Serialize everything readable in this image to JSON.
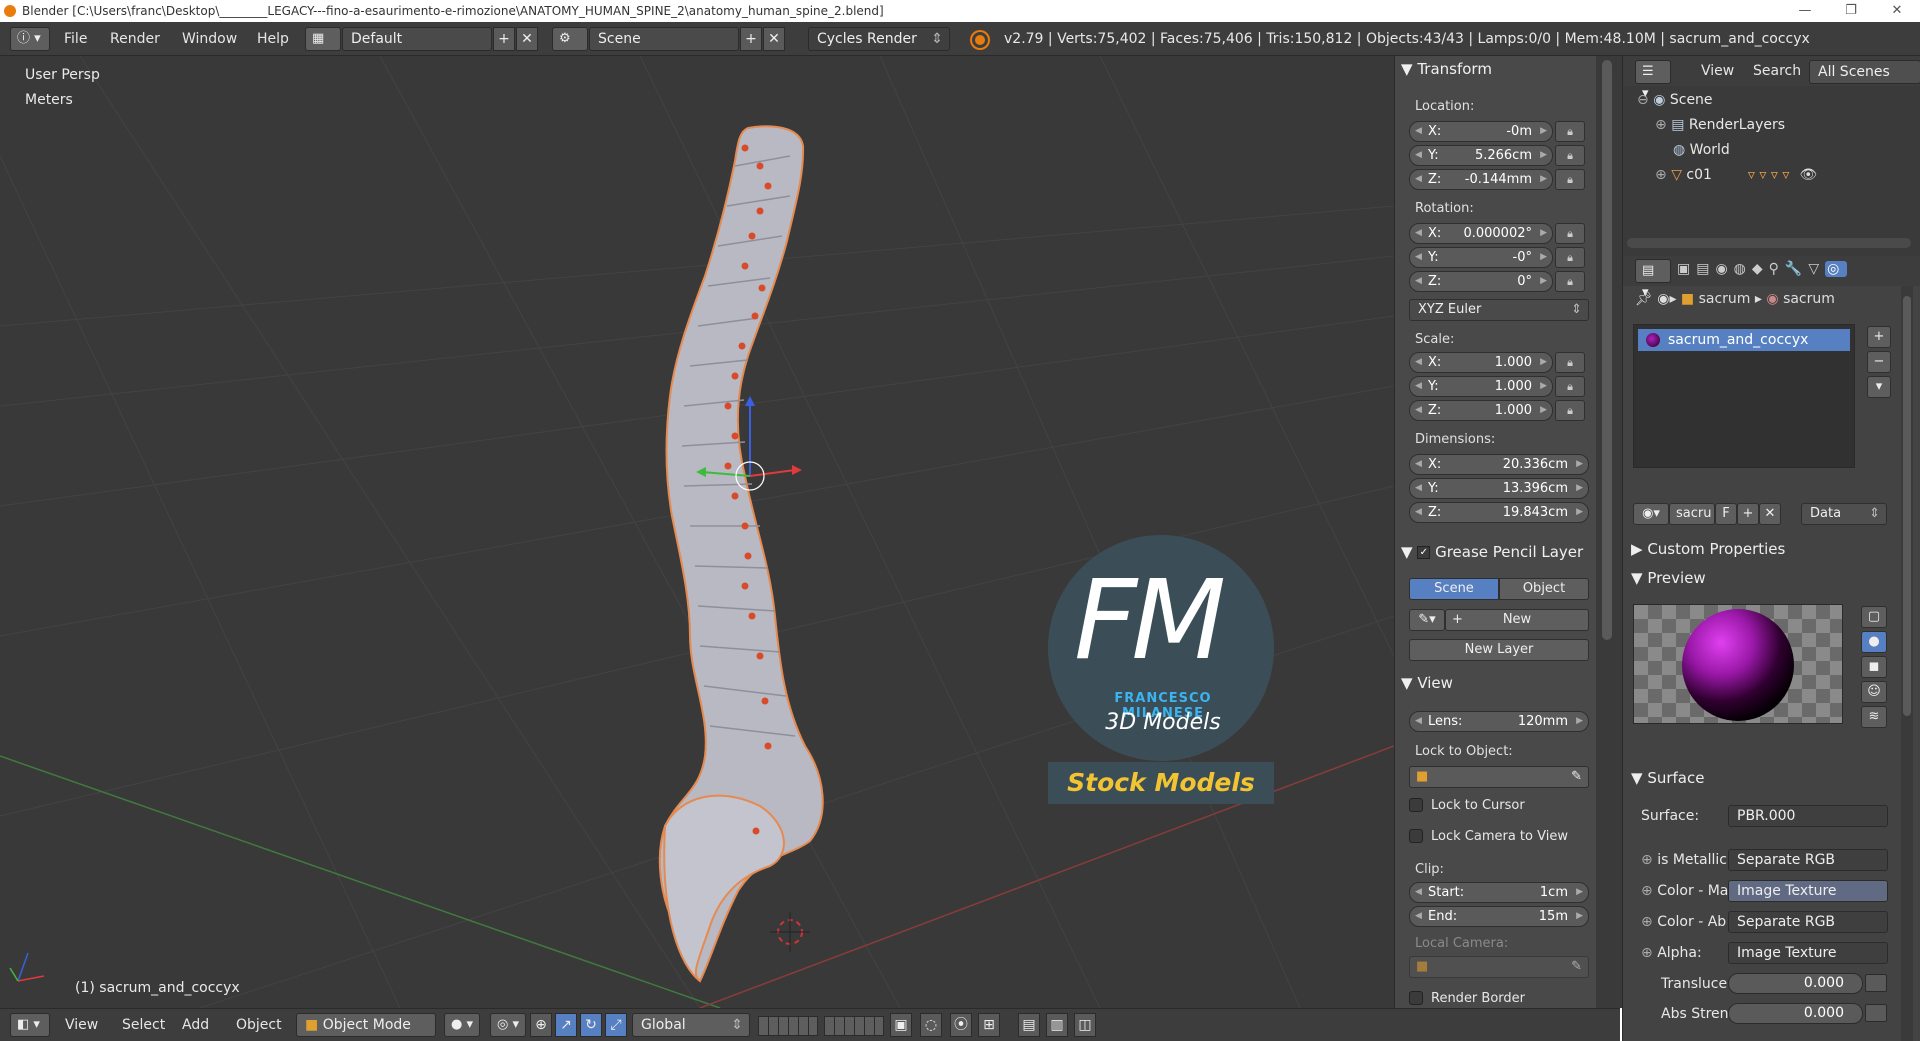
{
  "window": {
    "title": "Blender [C:\\Users\\franc\\Desktop\\________LEGACY---fino-a-esaurimento-e-rimozione\\ANATOMY_HUMAN_SPINE_2\\anatomy_human_spine_2.blend]",
    "minimize": "—",
    "maximize": "❐",
    "close": "✕"
  },
  "header": {
    "menus": [
      "File",
      "Render",
      "Window",
      "Help"
    ],
    "screen_layout": "Default",
    "scene": "Scene",
    "render_engine": "Cycles Render",
    "stats": "v2.79 | Verts:75,402 | Faces:75,406 | Tris:150,812 | Objects:43/43 | Lamps:0/0 | Mem:48.10M | sacrum_and_coccyx"
  },
  "viewport": {
    "view_name": "User Persp",
    "units": "Meters",
    "active_object": "(1) sacrum_and_coccyx",
    "watermark_initials": "FM",
    "watermark_name": "FRANCESCO MILANESE",
    "watermark_sub": "3D Models",
    "watermark_banner": "Stock Models"
  },
  "view3d_header": {
    "menus": [
      "View",
      "Select",
      "Add",
      "Object"
    ],
    "mode": "Object Mode",
    "orientation": "Global"
  },
  "transform": {
    "title": "Transform",
    "location_label": "Location:",
    "location": [
      {
        "axis": "X:",
        "value": "-0m"
      },
      {
        "axis": "Y:",
        "value": "5.266cm"
      },
      {
        "axis": "Z:",
        "value": "-0.144mm"
      }
    ],
    "rotation_label": "Rotation:",
    "rotation": [
      {
        "axis": "X:",
        "value": "0.000002°"
      },
      {
        "axis": "Y:",
        "value": "-0°"
      },
      {
        "axis": "Z:",
        "value": "0°"
      }
    ],
    "rotation_mode": "XYZ Euler",
    "scale_label": "Scale:",
    "scale": [
      {
        "axis": "X:",
        "value": "1.000"
      },
      {
        "axis": "Y:",
        "value": "1.000"
      },
      {
        "axis": "Z:",
        "value": "1.000"
      }
    ],
    "dimensions_label": "Dimensions:",
    "dimensions": [
      {
        "axis": "X:",
        "value": "20.336cm"
      },
      {
        "axis": "Y:",
        "value": "13.396cm"
      },
      {
        "axis": "Z:",
        "value": "19.843cm"
      }
    ]
  },
  "grease_pencil": {
    "title": "Grease Pencil Layer",
    "scene_tab": "Scene",
    "object_tab": "Object",
    "new_label": "New",
    "new_layer_label": "New Layer"
  },
  "view_panel": {
    "title": "View",
    "lens_label": "Lens:",
    "lens_value": "120mm",
    "lock_to_object": "Lock to Object:",
    "lock_to_cursor": "Lock to Cursor",
    "lock_camera": "Lock Camera to View",
    "clip_label": "Clip:",
    "clip_start_label": "Start:",
    "clip_start": "1cm",
    "clip_end_label": "End:",
    "clip_end": "15m",
    "local_camera": "Local Camera:",
    "render_border": "Render Border"
  },
  "outliner": {
    "menus": [
      "View",
      "Search"
    ],
    "filter": "All Scenes",
    "items": [
      "Scene",
      "RenderLayers",
      "World",
      "c01"
    ]
  },
  "properties": {
    "breadcrumb_object": "sacrum",
    "breadcrumb_material": "sacrum",
    "material_slot": "sacrum_and_coccyx",
    "material_name": "sacru",
    "fake_user": "F",
    "link": "Data",
    "custom_properties": "Custom Properties",
    "preview": "Preview",
    "surface_section": "Surface",
    "rows": [
      {
        "label": "Surface:",
        "value": "PBR.000"
      },
      {
        "label": "is Metallic",
        "value": "Separate RGB"
      },
      {
        "label": "Color - Ma",
        "value": "Image Texture"
      },
      {
        "label": "Color - Ab",
        "value": "Separate RGB"
      },
      {
        "label": "Alpha:",
        "value": "Image Texture"
      }
    ],
    "sliders": [
      {
        "label": "Transluce",
        "value": "0.000"
      },
      {
        "label": "Abs Stren",
        "value": "0.000"
      }
    ]
  }
}
